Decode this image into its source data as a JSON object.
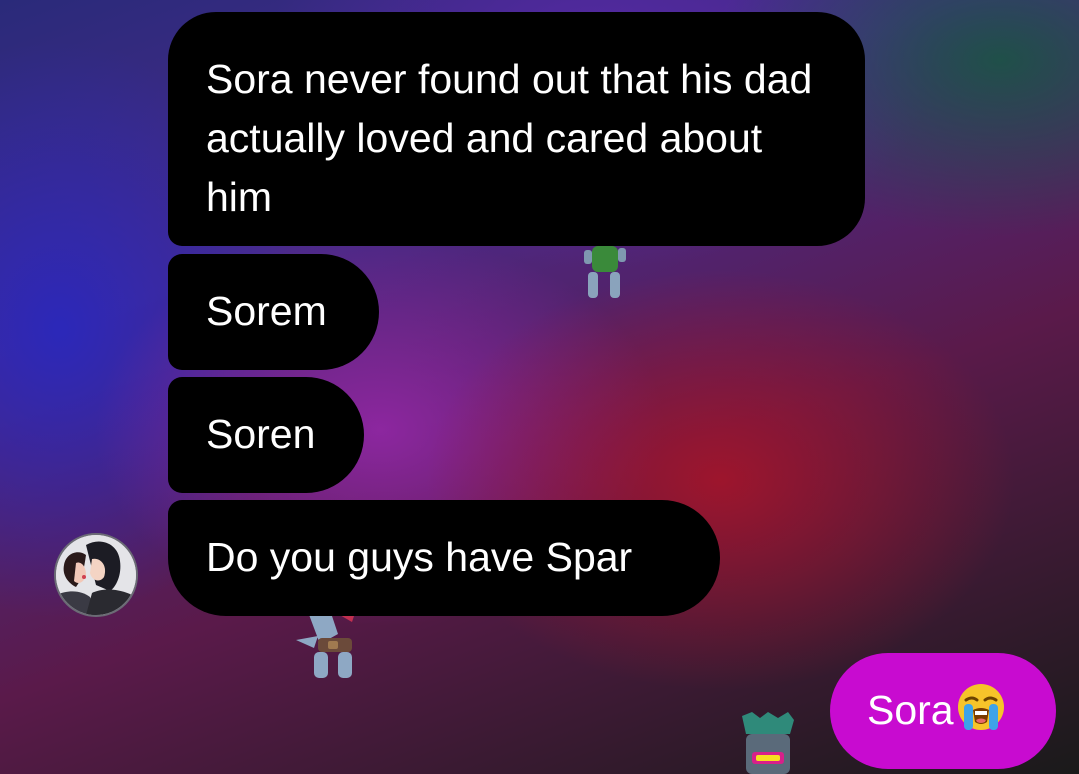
{
  "messages": [
    {
      "direction": "incoming",
      "text": "Sora never found out that his dad actually loved and cared about him"
    },
    {
      "direction": "incoming",
      "text": "Sorem"
    },
    {
      "direction": "incoming",
      "text": "Soren"
    },
    {
      "direction": "incoming",
      "text": "Do you guys have Spar"
    }
  ],
  "outgoing": {
    "text": "Sora",
    "emoji": "loudly-crying-face-emoji"
  },
  "sender": {
    "avatar_icon": "profile-avatar"
  },
  "colors": {
    "incoming_bubble": "#000000",
    "outgoing_bubble": "#c80bd0",
    "text": "#ffffff"
  }
}
